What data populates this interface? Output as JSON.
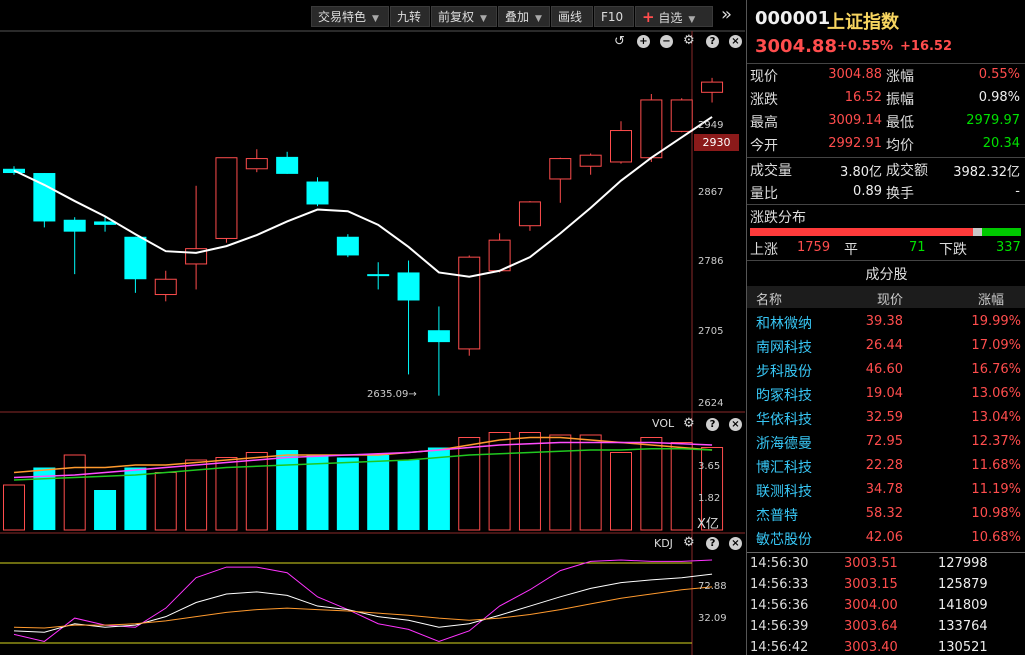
{
  "toolbar": {
    "buttons": [
      {
        "label": "交易特色",
        "dropdown": true
      },
      {
        "label": "九转",
        "dropdown": false
      },
      {
        "label": "前复权",
        "dropdown": true
      },
      {
        "label": "叠加",
        "dropdown": true
      },
      {
        "label": "画线",
        "dropdown": false
      },
      {
        "label": "F10",
        "dropdown": false
      },
      {
        "label": "自选",
        "dropdown": true
      }
    ],
    "more_glyph": "»"
  },
  "main_chart": {
    "price_axis": [
      "2949",
      "2867",
      "2786",
      "2705",
      "2624"
    ],
    "current_price_tag": "2930",
    "low_marker": "2635.09"
  },
  "vol_pane": {
    "label": "VOL",
    "axis": [
      "3.65",
      "1.82"
    ],
    "unit": "X亿"
  },
  "kdj_pane": {
    "label": "KDJ",
    "axis": [
      "72.88",
      "32.09"
    ]
  },
  "chart_data": {
    "type": "candlestick",
    "candles": [
      {
        "o": 2902,
        "h": 2905,
        "l": 2895,
        "c": 2897
      },
      {
        "o": 2897,
        "h": 2897,
        "l": 2833,
        "c": 2840
      },
      {
        "o": 2842,
        "h": 2845,
        "l": 2778,
        "c": 2828
      },
      {
        "o": 2840,
        "h": 2845,
        "l": 2828,
        "c": 2836
      },
      {
        "o": 2822,
        "h": 2822,
        "l": 2756,
        "c": 2772
      },
      {
        "o": 2754,
        "h": 2782,
        "l": 2746,
        "c": 2772
      },
      {
        "o": 2790,
        "h": 2882,
        "l": 2760,
        "c": 2808
      },
      {
        "o": 2820,
        "h": 2915,
        "l": 2815,
        "c": 2915
      },
      {
        "o": 2902,
        "h": 2925,
        "l": 2898,
        "c": 2914
      },
      {
        "o": 2916,
        "h": 2922,
        "l": 2896,
        "c": 2896
      },
      {
        "o": 2887,
        "h": 2892,
        "l": 2858,
        "c": 2860
      },
      {
        "o": 2822,
        "h": 2825,
        "l": 2798,
        "c": 2800
      },
      {
        "o": 2778,
        "h": 2792,
        "l": 2760,
        "c": 2777
      },
      {
        "o": 2780,
        "h": 2794,
        "l": 2660,
        "c": 2747
      },
      {
        "o": 2712,
        "h": 2740,
        "l": 2635,
        "c": 2698
      },
      {
        "o": 2690,
        "h": 2800,
        "l": 2682,
        "c": 2798
      },
      {
        "o": 2782,
        "h": 2826,
        "l": 2780,
        "c": 2818
      },
      {
        "o": 2835,
        "h": 2864,
        "l": 2829,
        "c": 2863
      },
      {
        "o": 2890,
        "h": 2915,
        "l": 2862,
        "c": 2914
      },
      {
        "o": 2905,
        "h": 2920,
        "l": 2895,
        "c": 2918
      },
      {
        "o": 2910,
        "h": 2958,
        "l": 2908,
        "c": 2947
      },
      {
        "o": 2915,
        "h": 2990,
        "l": 2910,
        "c": 2983
      },
      {
        "o": 2946,
        "h": 2985,
        "l": 2945,
        "c": 2983
      },
      {
        "o": 2992,
        "h": 3009,
        "l": 2980,
        "c": 3004
      }
    ],
    "ma": [
      2900,
      2883,
      2864,
      2846,
      2825,
      2805,
      2803,
      2811,
      2824,
      2840,
      2854,
      2852,
      2836,
      2810,
      2780,
      2775,
      2782,
      2798,
      2826,
      2856,
      2888,
      2915,
      2939,
      2963
    ],
    "volume": [
      1.8,
      2.5,
      3.0,
      1.6,
      2.5,
      2.3,
      2.8,
      2.9,
      3.1,
      3.2,
      3.0,
      2.9,
      3.0,
      2.8,
      3.3,
      3.7,
      3.9,
      3.9,
      3.8,
      3.8,
      3.1,
      3.7,
      3.5,
      3.3
    ],
    "volume_up": [
      true,
      false,
      true,
      false,
      false,
      true,
      true,
      true,
      true,
      false,
      false,
      false,
      false,
      false,
      false,
      true,
      true,
      true,
      true,
      true,
      true,
      true,
      true,
      true
    ],
    "vol_ma": [
      [
        2.3,
        2.4,
        2.5,
        2.5,
        2.6,
        2.6,
        2.7,
        2.8,
        2.9,
        3.0,
        3.0,
        3.0,
        3.0,
        3.1,
        3.2,
        3.4,
        3.6,
        3.7,
        3.7,
        3.6,
        3.5,
        3.4,
        3.3,
        3.2
      ],
      [
        2.1,
        2.15,
        2.2,
        2.3,
        2.4,
        2.5,
        2.6,
        2.7,
        2.8,
        2.9,
        2.95,
        3.0,
        3.05,
        3.1,
        3.2,
        3.3,
        3.4,
        3.45,
        3.5,
        3.5,
        3.5,
        3.5,
        3.45,
        3.4
      ],
      [
        2.0,
        2.05,
        2.1,
        2.15,
        2.2,
        2.3,
        2.4,
        2.5,
        2.55,
        2.6,
        2.65,
        2.7,
        2.75,
        2.8,
        2.9,
        3.0,
        3.05,
        3.1,
        3.15,
        3.2,
        3.2,
        3.25,
        3.25,
        3.2
      ]
    ],
    "kdj_k": [
      10,
      8,
      20,
      15,
      18,
      30,
      50,
      62,
      65,
      60,
      45,
      40,
      30,
      25,
      15,
      20,
      32,
      45,
      58,
      70,
      78,
      82,
      85,
      90
    ],
    "kdj_d": [
      15,
      14,
      18,
      18,
      20,
      24,
      30,
      36,
      40,
      42,
      40,
      38,
      35,
      32,
      28,
      25,
      28,
      33,
      40,
      48,
      56,
      62,
      68,
      72
    ],
    "kdj_j": [
      5,
      -5,
      28,
      18,
      15,
      42,
      85,
      100,
      100,
      92,
      58,
      40,
      20,
      12,
      -5,
      10,
      45,
      68,
      95,
      108,
      110,
      108,
      108,
      110
    ]
  },
  "header": {
    "code": "000001",
    "name": "上证指数",
    "price": "3004.88",
    "pct": "+0.55%",
    "change": "+16.52"
  },
  "quote": {
    "rows": [
      {
        "l1": "现价",
        "v1": "3004.88",
        "c1": "red",
        "l2": "涨幅",
        "v2": "0.55%",
        "c2": "red"
      },
      {
        "l1": "涨跌",
        "v1": "16.52",
        "c1": "red",
        "l2": "振幅",
        "v2": "0.98%",
        "c2": "white"
      },
      {
        "l1": "最高",
        "v1": "3009.14",
        "c1": "red",
        "l2": "最低",
        "v2": "2979.97",
        "c2": "green"
      },
      {
        "l1": "今开",
        "v1": "2992.91",
        "c1": "red",
        "l2": "均价",
        "v2": "20.34",
        "c2": "green"
      }
    ],
    "rows2": [
      {
        "l1": "成交量",
        "v1": "3.80亿",
        "c1": "white",
        "l2": "成交额",
        "v2": "3982.32亿",
        "c2": "white"
      },
      {
        "l1": "量比",
        "v1": "0.89",
        "c1": "white",
        "l2": "换手",
        "v2": "-",
        "c2": "white"
      }
    ]
  },
  "distribution": {
    "title": "涨跌分布",
    "up_label": "上涨",
    "up": "1759",
    "flat_label": "平",
    "flat": "71",
    "down_label": "下跌",
    "down": "337",
    "bar_up_frac": 0.822,
    "bar_flat_frac": 0.033
  },
  "constituents": {
    "title": "成分股",
    "headers": {
      "name": "名称",
      "price": "现价",
      "pct": "涨幅"
    },
    "rows": [
      {
        "name": "和林微纳",
        "price": "39.38",
        "pct": "19.99%"
      },
      {
        "name": "南网科技",
        "price": "26.44",
        "pct": "17.09%"
      },
      {
        "name": "步科股份",
        "price": "46.60",
        "pct": "16.76%"
      },
      {
        "name": "昀冢科技",
        "price": "19.04",
        "pct": "13.06%"
      },
      {
        "name": "华依科技",
        "price": "32.59",
        "pct": "13.04%"
      },
      {
        "name": "浙海德曼",
        "price": "72.95",
        "pct": "12.37%"
      },
      {
        "name": "博汇科技",
        "price": "22.28",
        "pct": "11.68%"
      },
      {
        "name": "联测科技",
        "price": "34.78",
        "pct": "11.19%"
      },
      {
        "name": "杰普特",
        "price": "58.32",
        "pct": "10.98%"
      },
      {
        "name": "敏芯股份",
        "price": "42.06",
        "pct": "10.68%"
      }
    ]
  },
  "ticks": [
    {
      "time": "14:56:30",
      "price": "3003.51",
      "vol": "127998"
    },
    {
      "time": "14:56:33",
      "price": "3003.15",
      "vol": "125879"
    },
    {
      "time": "14:56:36",
      "price": "3004.00",
      "vol": "141809"
    },
    {
      "time": "14:56:39",
      "price": "3003.64",
      "vol": "133764"
    },
    {
      "time": "14:56:42",
      "price": "3003.40",
      "vol": "130521"
    }
  ],
  "colors": {
    "up": "#ff4d4d",
    "down": "#00ffff",
    "ma": "#ffffff",
    "accent": "#ff4d4d",
    "name_blue": "#37c6f4"
  }
}
